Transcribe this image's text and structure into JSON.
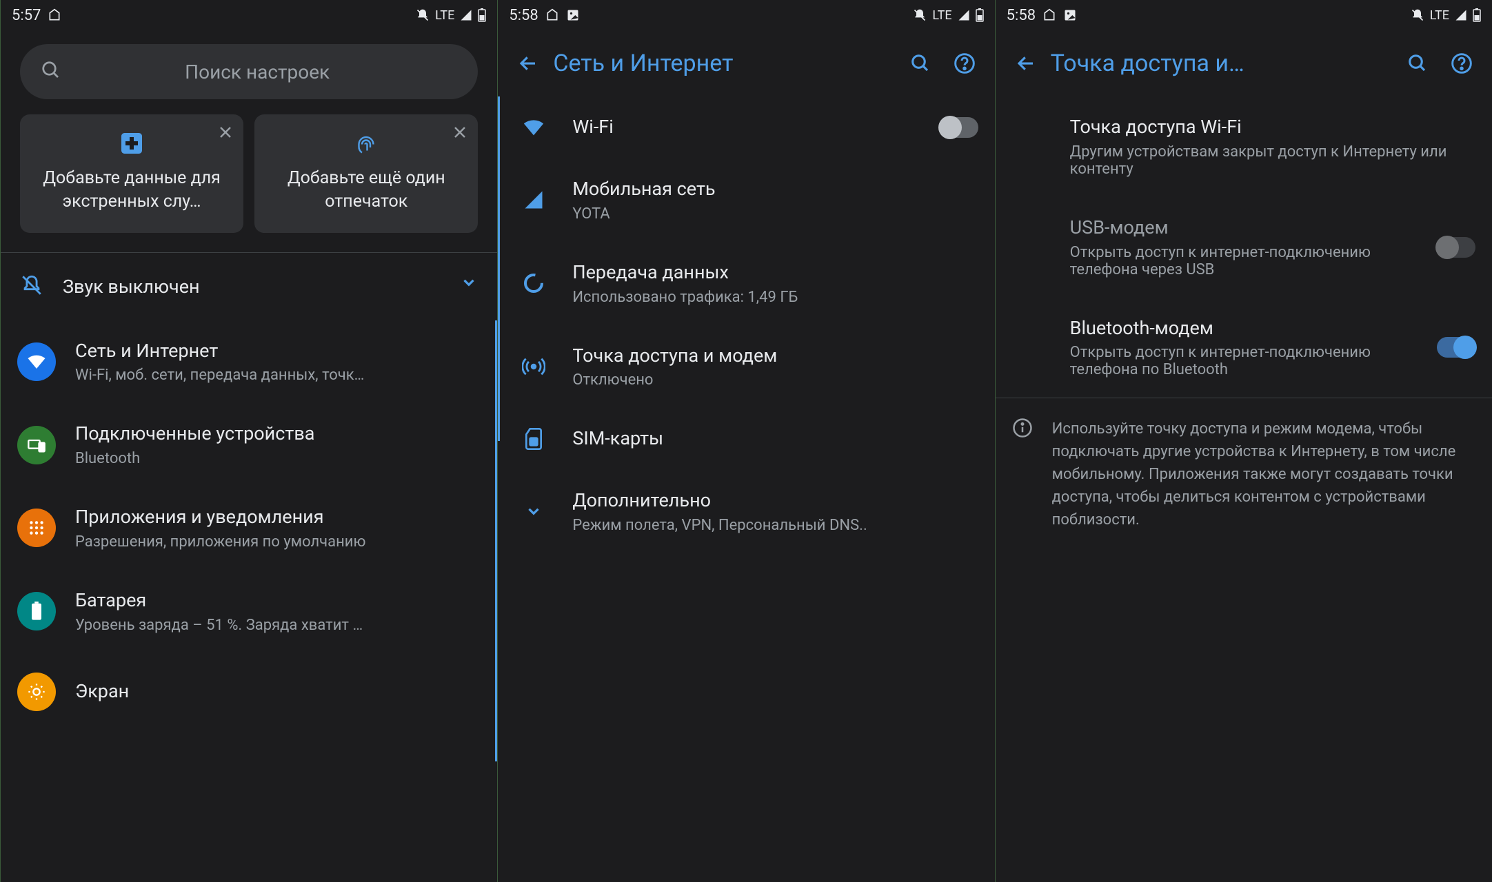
{
  "statusbars": {
    "p1": {
      "time": "5:57",
      "net": "LTE"
    },
    "p2": {
      "time": "5:58",
      "net": "LTE"
    },
    "p3": {
      "time": "5:58",
      "net": "LTE"
    }
  },
  "panel1": {
    "search_placeholder": "Поиск настроек",
    "cards": {
      "emergency": "Добавьте данные для экстренных слу…",
      "fingerprint": "Добавьте ещё один отпечаток"
    },
    "sound_row": "Звук выключен",
    "items": [
      {
        "title": "Сеть и Интернет",
        "sub": "Wi-Fi, моб. сети, передача данных, точк…"
      },
      {
        "title": "Подключенные устройства",
        "sub": "Bluetooth"
      },
      {
        "title": "Приложения и уведомления",
        "sub": "Разрешения, приложения по умолчанию"
      },
      {
        "title": "Батарея",
        "sub": "Уровень заряда – 51 %. Заряда хватит …"
      },
      {
        "title": "Экран",
        "sub": ""
      }
    ]
  },
  "panel2": {
    "title": "Сеть и Интернет",
    "items": {
      "wifi": {
        "title": "Wi-Fi"
      },
      "mobile": {
        "title": "Мобильная сеть",
        "sub": "YOTA"
      },
      "data": {
        "title": "Передача данных",
        "sub": "Использовано трафика: 1,49 ГБ"
      },
      "hotspot": {
        "title": "Точка доступа и модем",
        "sub": "Отключено"
      },
      "sim": {
        "title": "SIM-карты"
      },
      "more": {
        "title": "Дополнительно",
        "sub": "Режим полета, VPN, Персональный DNS.."
      }
    }
  },
  "panel3": {
    "title": "Точка доступа и…",
    "items": {
      "wifi_ap": {
        "title": "Точка доступа Wi-Fi",
        "sub": "Другим устройствам закрыт доступ к Интернету или контенту"
      },
      "usb": {
        "title": "USB-модем",
        "sub": "Открыть доступ к интернет-подключению телефона через USB"
      },
      "bt": {
        "title": "Bluetooth-модем",
        "sub": "Открыть доступ к интернет-подключению телефона по Bluetooth"
      }
    },
    "info": "Используйте точку доступа и режим модема, чтобы подключать другие устройства к Интернету, в том числе мобильному. Приложения также могут создавать точки доступа, чтобы делиться контентом с устройствами поблизости."
  }
}
